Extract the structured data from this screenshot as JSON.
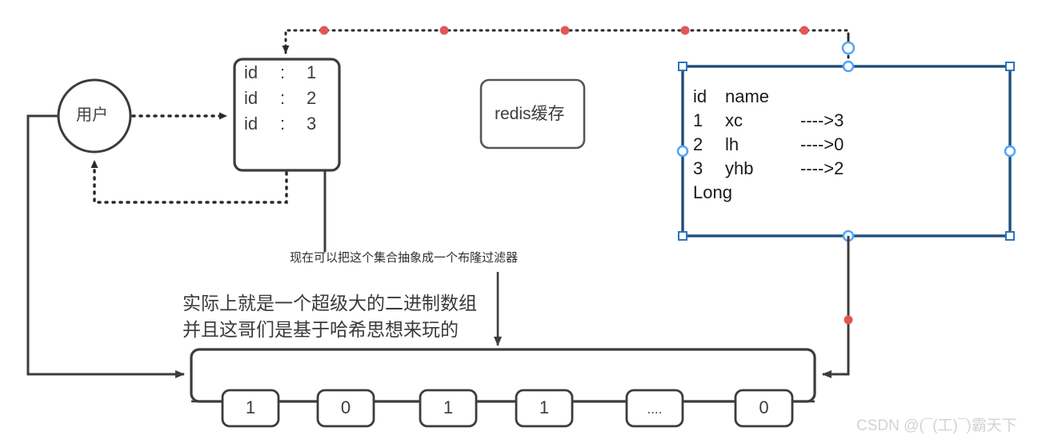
{
  "diagram": {
    "user_node": {
      "label": "用户"
    },
    "id_box": {
      "rows": [
        {
          "key": "id",
          "sep": ":",
          "value": "1"
        },
        {
          "key": "id",
          "sep": ":",
          "value": "2"
        },
        {
          "key": "id",
          "sep": ":",
          "value": "3"
        }
      ]
    },
    "redis_box": {
      "label": "redis缓存"
    },
    "table_box": {
      "selected": true,
      "header": {
        "id": "id",
        "name": "name"
      },
      "rows": [
        {
          "id": "1",
          "name": "xc",
          "arrow": "---->3"
        },
        {
          "id": "2",
          "name": "lh",
          "arrow": "---->0"
        },
        {
          "id": "3",
          "name": "yhb",
          "arrow": "---->2"
        }
      ],
      "footer": "Long"
    },
    "annotations": {
      "bloom_note": "现在可以把这个集合抽象成一个布隆过滤器",
      "array_note_line1": "实际上就是一个超级大的二进制数组",
      "array_note_line2": "并且这哥们是基于哈希思想来玩的"
    },
    "bit_array": {
      "cells": [
        "1",
        "0",
        "1",
        "1",
        "....",
        "0"
      ]
    },
    "watermark": "CSDN @(¯(工)¯)霸天下",
    "colors": {
      "stroke": "#3c3c3c",
      "selection": "#1f4e79",
      "handle": "#4da6ff",
      "dot": "#e15759",
      "watermark": "#d2d2d2"
    }
  }
}
